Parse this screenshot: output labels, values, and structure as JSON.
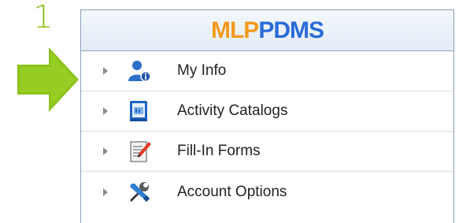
{
  "step": {
    "number": "1"
  },
  "colors": {
    "step_green": "#8cc21b",
    "logo_orange": "#f39a1d",
    "logo_blue": "#2a6bd8",
    "panel_border": "#8a9fbd"
  },
  "logo": {
    "part1": "MLP",
    "part2": "PDMS"
  },
  "menu": {
    "items": [
      {
        "label": "My Info",
        "icon": "user-info-icon"
      },
      {
        "label": "Activity Catalogs",
        "icon": "catalog-icon"
      },
      {
        "label": "Fill-In Forms",
        "icon": "form-edit-icon"
      },
      {
        "label": "Account Options",
        "icon": "tools-icon"
      }
    ]
  }
}
